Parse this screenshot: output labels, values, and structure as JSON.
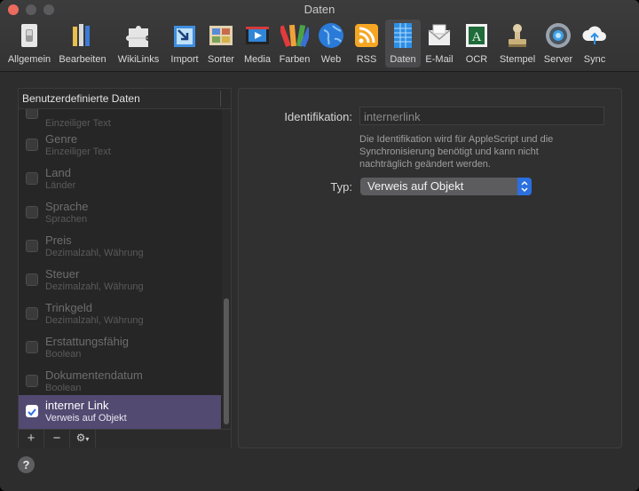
{
  "window": {
    "title": "Daten"
  },
  "toolbar": {
    "items": [
      {
        "label": "Allgemein",
        "icon": "switch-icon"
      },
      {
        "label": "Bearbeiten",
        "icon": "pencils-icon"
      },
      {
        "label": "WikiLinks",
        "icon": "puzzle-icon"
      },
      {
        "label": "Import",
        "icon": "import-icon"
      },
      {
        "label": "Sorter",
        "icon": "sorter-icon"
      },
      {
        "label": "Media",
        "icon": "media-icon"
      },
      {
        "label": "Farben",
        "icon": "colors-icon"
      },
      {
        "label": "Web",
        "icon": "globe-icon"
      },
      {
        "label": "RSS",
        "icon": "rss-icon"
      },
      {
        "label": "Daten",
        "icon": "data-table-icon",
        "selected": true
      },
      {
        "label": "E-Mail",
        "icon": "envelope-icon"
      },
      {
        "label": "OCR",
        "icon": "ocr-icon"
      },
      {
        "label": "Stempel",
        "icon": "stamp-icon"
      },
      {
        "label": "Server",
        "icon": "server-icon"
      },
      {
        "label": "Sync",
        "icon": "cloud-sync-icon"
      }
    ]
  },
  "list": {
    "header": "Benutzerdefinierte Daten",
    "items": [
      {
        "name": "",
        "subtitle": "Einzeiliger Text"
      },
      {
        "name": "Genre",
        "subtitle": "Einzeiliger Text"
      },
      {
        "name": "Land",
        "subtitle": "Länder"
      },
      {
        "name": "Sprache",
        "subtitle": "Sprachen"
      },
      {
        "name": "Preis",
        "subtitle": "Dezimalzahl, Währung"
      },
      {
        "name": "Steuer",
        "subtitle": "Dezimalzahl, Währung"
      },
      {
        "name": "Trinkgeld",
        "subtitle": "Dezimalzahl, Währung"
      },
      {
        "name": "Erstattungsfähig",
        "subtitle": "Boolean"
      },
      {
        "name": "Dokumentendatum",
        "subtitle": "Boolean"
      },
      {
        "name": "interner Link",
        "subtitle": "Verweis auf Objekt",
        "selected": true,
        "checked": true
      }
    ],
    "buttons": {
      "add": "+",
      "remove": "−",
      "action": "⚙"
    }
  },
  "detail": {
    "identification_label": "Identifikation:",
    "identification_value": "internerlink",
    "help_text": "Die Identifikation wird für AppleScript und die Synchronisierung benötigt und kann nicht nachträglich geändert werden.",
    "type_label": "Typ:",
    "type_value": "Verweis auf Objekt"
  },
  "help_button": "?",
  "colors": {
    "accent": "#2b6fe0",
    "selection": "#524a71"
  }
}
